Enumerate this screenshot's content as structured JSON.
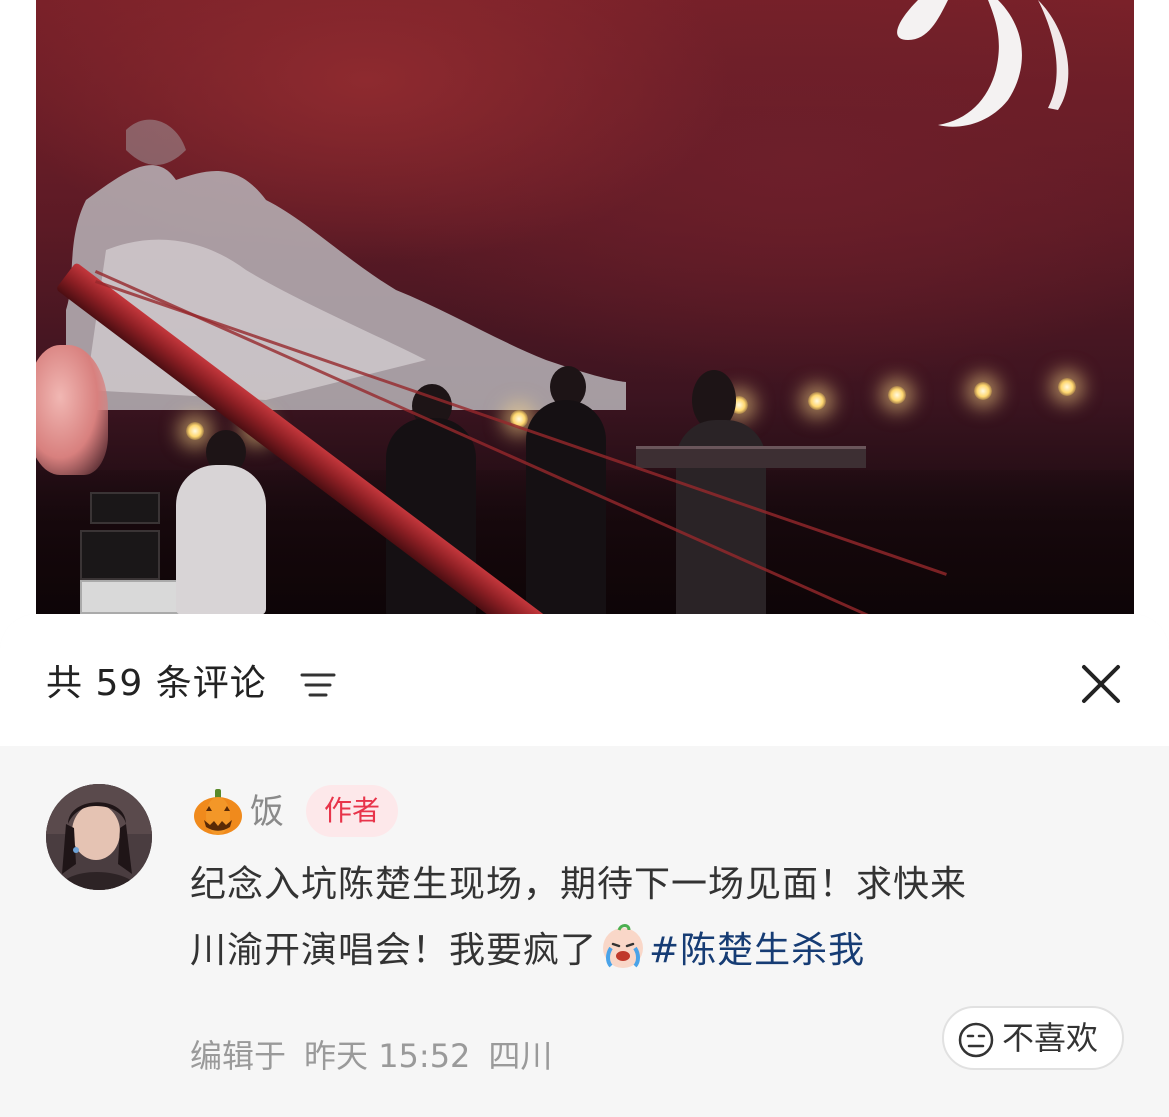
{
  "photo": {
    "description_icon": "concert-photo"
  },
  "comments_panel": {
    "count_label": "共 59 条评论",
    "sort_icon": "filter-lines-icon",
    "close_icon": "close-x-icon"
  },
  "comment": {
    "avatar_icon": "user-avatar",
    "user_prefix_icon": "pumpkin-emoji-icon",
    "username": "饭",
    "badge": "作者",
    "text_line1": "纪念入坑陈楚生现场，期待下一场见面！求快来",
    "text_line2_start": "川渝开演唱会！我要疯了",
    "emoji_icon": "crying-face-emoji-icon",
    "hashtag": "#陈楚生杀我",
    "edited_label": "编辑于",
    "time": "昨天 15:52",
    "location": "四川",
    "dislike_icon": "neutral-face-icon",
    "dislike_label": "不喜欢"
  },
  "colors": {
    "badge_text": "#e8344a",
    "badge_bg": "#fde8ea",
    "hashtag": "#163c74",
    "sheet_bg": "#f6f6f6"
  }
}
